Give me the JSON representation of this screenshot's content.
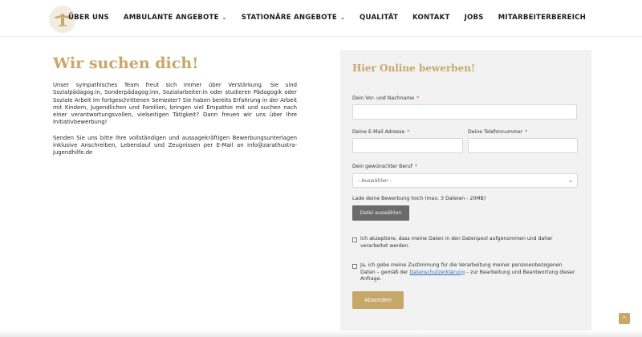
{
  "nav": {
    "items": [
      {
        "label": "ÜBER UNS",
        "dropdown": false
      },
      {
        "label": "AMBULANTE ANGEBOTE",
        "dropdown": true
      },
      {
        "label": "STATIONÄRE ANGEBOTE",
        "dropdown": true
      },
      {
        "label": "QUALITÄT",
        "dropdown": false
      },
      {
        "label": "KONTAKT",
        "dropdown": false
      },
      {
        "label": "JOBS",
        "dropdown": false
      },
      {
        "label": "MITARBEITERBEREICH",
        "dropdown": false
      }
    ]
  },
  "intro": {
    "heading": "Wir suchen dich!",
    "paragraph1": "Unser sympathisches Team freut sich immer über Verstärkung. Sie sind Sozialpädagog:in, Sonderpädagog:inn, Sozialarbeiter:in oder studieren Pädagogik oder Soziale Arbeit im fortgeschrittenen Semester? Sie haben bereits Erfahrung in der Arbeit mit Kindern, Jugendlichen und Familien, bringen viel Empathie mit und suchen nach einer verantwortungsvollen, vielseitigen Tätigkeit? Dann freuen wir uns über Ihre Initiativbewerbung!",
    "paragraph2": "Senden Sie uns bitte Ihre vollständigen und aussagekräftigen Bewerbungsunterlagen inklusive Anschreiben, Lebenslauf und Zeugnissen per E-Mail an info@zarathustra-jugendhilfe.de"
  },
  "form": {
    "title": "Hier Online bewerben!",
    "name_label": "Dein Vor- und Nachname",
    "name_value": "",
    "email_label": "Deine E-Mail Adresse",
    "email_value": "",
    "phone_label": "Deine Telefonnummer",
    "phone_value": "",
    "job_label": "Dein gewünschter Beruf",
    "job_selected": "- Auswählen -",
    "upload_label": "Lade deine Bewerbung hoch (max. 3 Dateien - 20MB)",
    "upload_button": "Datei auswählen",
    "required_mark": "*",
    "consent1": "Ich akzeptiere, dass meine Daten in den Datenpool aufgenommen und daher verarbeitet werden.",
    "consent2_before": "Ja, ich gebe meine Zustimmung für die Verarbeitung meiner personenbezogenen Daten – gemäß der",
    "consent2_link": "Datenschutzerklärung",
    "consent2_after": "– zur Bearbeitung und Beantwortung dieser Anfrage.",
    "submit": "Absenden"
  },
  "colors": {
    "accent": "#c8a76a",
    "panel_bg": "#f2f2f2",
    "file_button": "#6b6b6b"
  },
  "icons": [
    "logo-icon",
    "chevron-down-icon",
    "scroll-to-top-icon"
  ]
}
